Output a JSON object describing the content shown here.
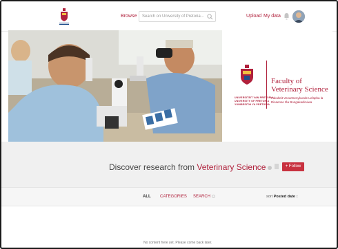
{
  "header": {
    "browse_label": "Browse",
    "search_placeholder": "Search on University of Pretoria...",
    "upload_label": "Upload",
    "my_data_label": "My data",
    "icons": [
      "university-logo-icon",
      "search-icon",
      "bell-icon",
      "avatar"
    ]
  },
  "banner": {
    "university_lines": [
      "UNIVERSITEIT VAN PRETORIA",
      "UNIVERSITY OF PRETORIA",
      "YUNIBESITHI YA PRETORIA"
    ],
    "faculty_title": "Faculty of Veterinary Science",
    "faculty_sub": "Fakulteit Veeartsenykunde Lefapha la Disaense tša Bongakadiruiwa"
  },
  "discover": {
    "prefix": "Discover research from ",
    "highlight": "Veterinary Science",
    "follow_label": "+ Follow"
  },
  "filters": {
    "tabs": [
      "ALL",
      "CATEGORIES",
      "SEARCH"
    ],
    "sort_prefix": "sort",
    "sort_value": "Posted date"
  },
  "content": {
    "empty_message": "No content here yet. Please come back later."
  },
  "colors": {
    "accent": "#b0213c",
    "follow_button": "#c8313f"
  }
}
